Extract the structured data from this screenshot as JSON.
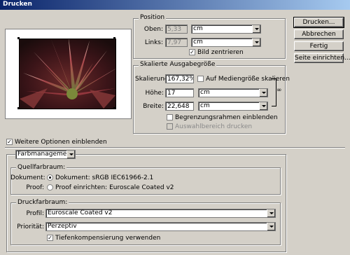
{
  "window": {
    "title": "Drucken"
  },
  "buttons": {
    "print": "Drucken...",
    "cancel": "Abbrechen",
    "done": "Fertig",
    "page_setup": "Seite einrichten..."
  },
  "position": {
    "title": "Position",
    "top_label": "Oben:",
    "top_value": "5,33",
    "top_unit": "cm",
    "left_label": "Links:",
    "left_value": "7,97",
    "left_unit": "cm",
    "center_label": "Bild zentrieren",
    "center_checked": true
  },
  "scaled": {
    "title": "Skalierte Ausgabegröße",
    "scale_label": "Skalierung:",
    "scale_value": "167,32%",
    "fit_label": "Auf Mediengröße skalieren",
    "fit_checked": false,
    "height_label": "Höhe:",
    "height_value": "17",
    "height_unit": "cm",
    "width_label": "Breite:",
    "width_value": "22,648",
    "width_unit": "cm",
    "border_label": "Begrenzungsrahmen einblenden",
    "border_checked": false,
    "selection_label": "Auswahlbereich drucken",
    "selection_checked": false
  },
  "more_options": {
    "label": "Weitere Optionen einblenden",
    "checked": true
  },
  "color_management": {
    "dropdown_value": "Farbmanagement",
    "source": {
      "title": "Quellfarbraum:",
      "document_label": "Dokument:",
      "document_option": "Dokument: sRGB IEC61966-2.1",
      "proof_label": "Proof:",
      "proof_option": "Proof einrichten: Euroscale Coated v2",
      "selected": "document"
    },
    "print_space": {
      "title": "Druckfarbraum:",
      "profile_label": "Profil:",
      "profile_value": "Euroscale Coated v2",
      "intent_label": "Priorität:",
      "intent_value": "Perzeptiv",
      "bpc_label": "Tiefenkompensierung verwenden",
      "bpc_checked": true
    }
  },
  "colors": {
    "titlebar_start": "#0a246a",
    "titlebar_end": "#a6caf0",
    "dialog_bg": "#d4d0c8"
  }
}
